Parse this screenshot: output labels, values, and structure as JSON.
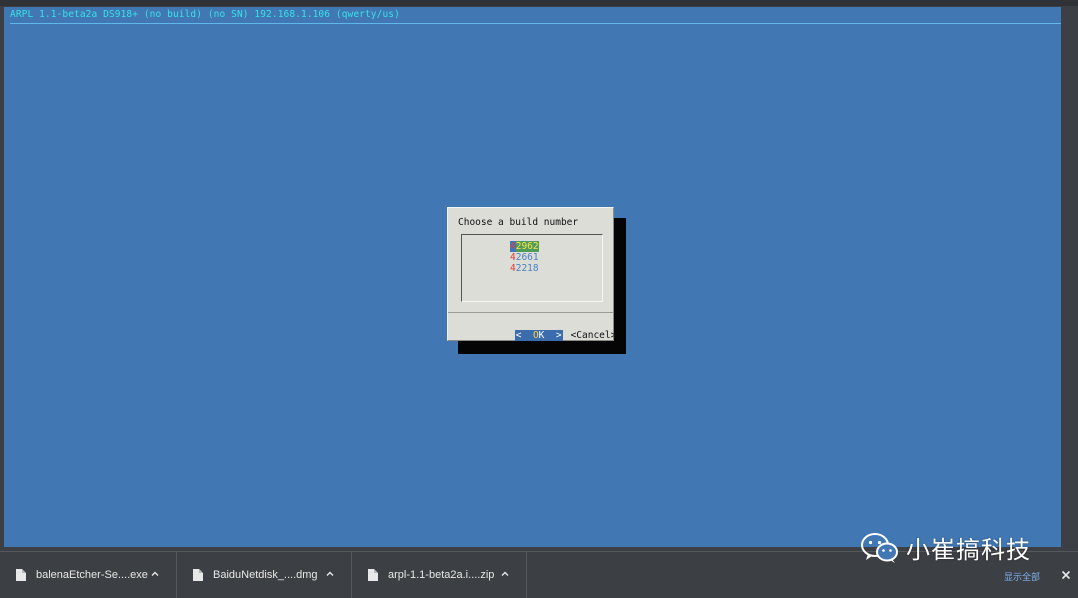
{
  "terminal": {
    "title": "ARPL 1.1-beta2a DS918+ (no build) (no SN) 192.168.1.106 (qwerty/us)",
    "colors": {
      "background": "#4178b3",
      "title": "#38e1e8"
    }
  },
  "dialog": {
    "title": "Choose a build number",
    "menu_items": [
      {
        "hotkey": "4",
        "rest": "2962",
        "selected": true
      },
      {
        "hotkey": "4",
        "rest": "2661",
        "selected": false
      },
      {
        "hotkey": "4",
        "rest": "2218",
        "selected": false
      }
    ],
    "ok_left": "<  ",
    "ok_hot": "O",
    "ok_rest": "K",
    "ok_right": "  >",
    "cancel_label": "<Cancel>"
  },
  "downloads": {
    "items": [
      {
        "name": "balenaEtcher-Se....exe",
        "icon": "file-icon"
      },
      {
        "name": "BaiduNetdisk_....dmg",
        "icon": "file-icon"
      },
      {
        "name": "arpl-1.1-beta2a.i....zip",
        "icon": "file-icon"
      }
    ],
    "show_all_label": "显示全部",
    "close_icon": "close-icon"
  },
  "watermark": {
    "text": "小崔搞科技",
    "icon": "wechat-logo-icon"
  }
}
